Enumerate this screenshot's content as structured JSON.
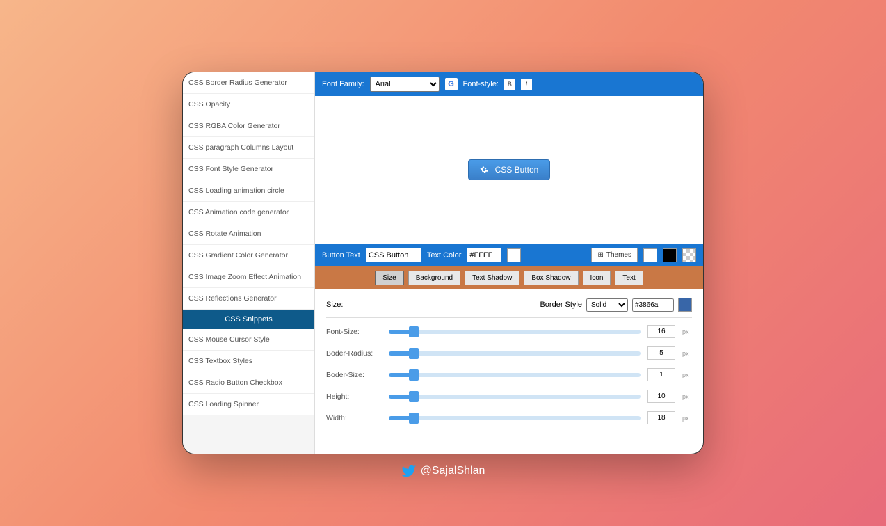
{
  "sidebar": {
    "items": [
      "CSS Border Radius Generator",
      "CSS Opacity",
      "CSS RGBA Color Generator",
      "CSS paragraph Columns Layout",
      "CSS Font Style Generator",
      "CSS Loading animation circle",
      "CSS Animation code generator",
      "CSS Rotate Animation",
      "CSS Gradient Color Generator",
      "CSS Image Zoom Effect Animation",
      "CSS Reflections Generator"
    ],
    "header": "CSS Snippets",
    "items2": [
      "CSS Mouse Cursor Style",
      "CSS Textbox Styles",
      "CSS Radio Button Checkbox",
      "CSS Loading Spinner"
    ]
  },
  "topbar": {
    "fontFamilyLabel": "Font Family:",
    "fontFamily": "Arial",
    "fontStyleLabel": "Font-style:",
    "bold": "B",
    "italic": "I"
  },
  "preview": {
    "buttonText": "CSS Button"
  },
  "midbar": {
    "btnTextLabel": "Button Text",
    "btnText": "CSS Button",
    "textColorLabel": "Text Color",
    "textColor": "#FFFF",
    "themes": "Themes"
  },
  "tabs": [
    "Size",
    "Background",
    "Text Shadow",
    "Box Shadow",
    "Icon",
    "Text"
  ],
  "panel": {
    "title": "Size:",
    "borderStyleLabel": "Border Style",
    "borderStyle": "Solid",
    "borderColor": "#3866a",
    "sliders": [
      {
        "label": "Font-Size:",
        "value": "16",
        "unit": "px"
      },
      {
        "label": "Boder-Radius:",
        "value": "5",
        "unit": "px"
      },
      {
        "label": "Boder-Size:",
        "value": "1",
        "unit": "px"
      },
      {
        "label": "Height:",
        "value": "10",
        "unit": "px"
      },
      {
        "label": "Width:",
        "value": "18",
        "unit": "px"
      }
    ]
  },
  "handle": "@SajalShlan"
}
